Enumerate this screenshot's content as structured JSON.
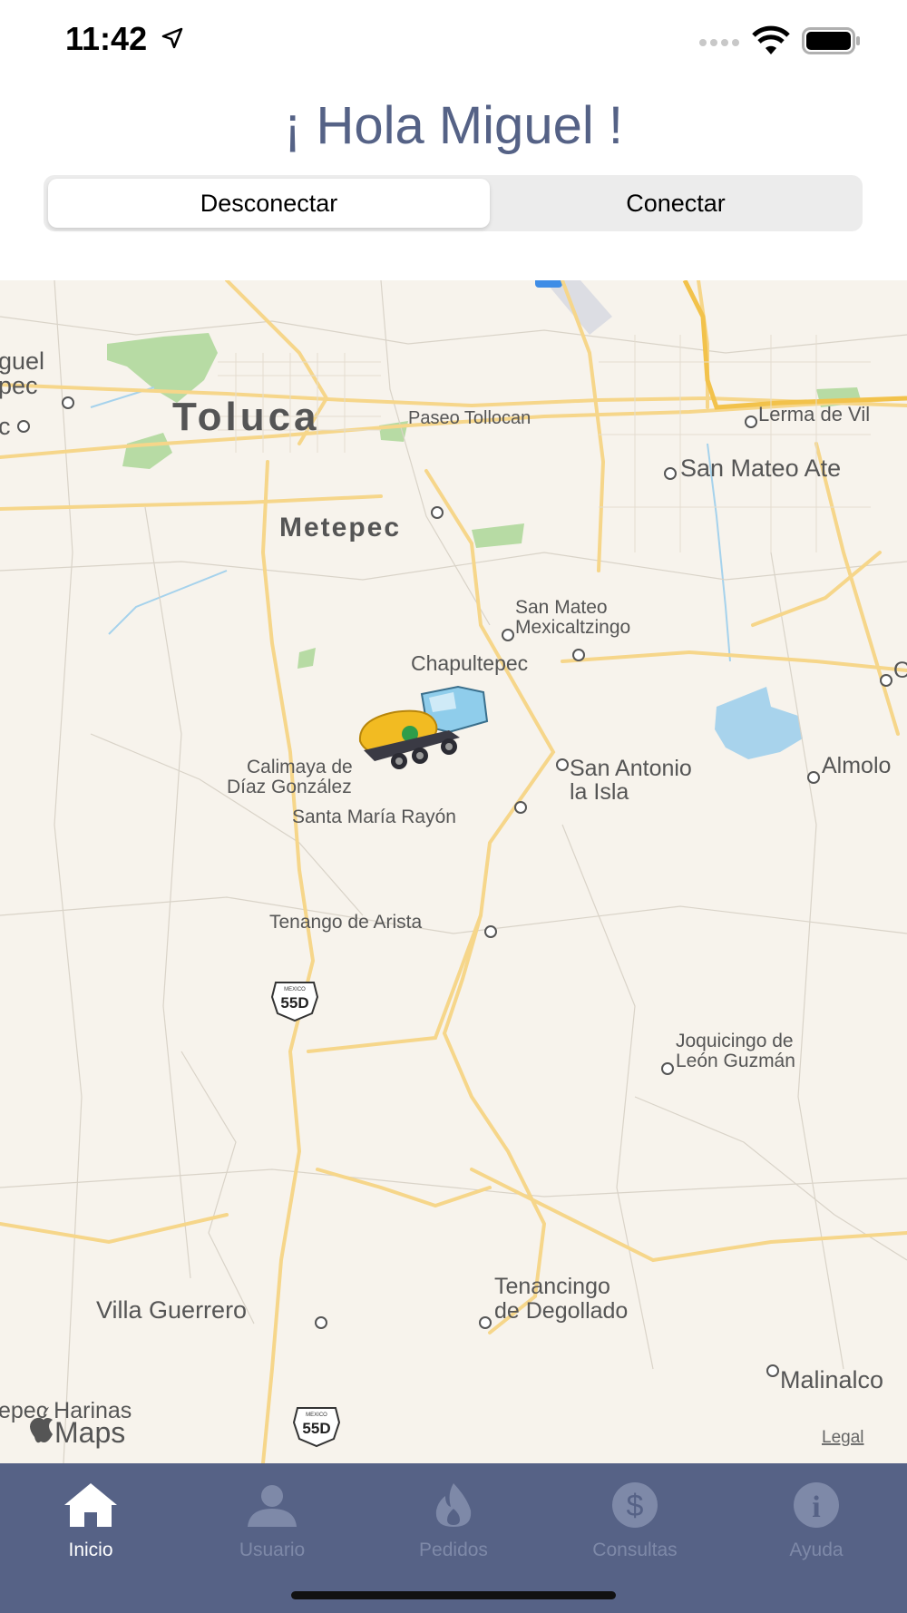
{
  "status_bar": {
    "time": "11:42"
  },
  "greeting": "¡ Hola Miguel !",
  "segmented": {
    "options": [
      "Desconectar",
      "Conectar"
    ],
    "selected": "Desconectar"
  },
  "map": {
    "labels": {
      "toluca": "Toluca",
      "metepec": "Metepec",
      "paseo": "Paseo Tollocan",
      "lerma": "Lerma de Vil",
      "san_mateo_ate": "San Mateo Ate",
      "miguel_l1": "guel",
      "miguel_l2": "pec",
      "c_left": "c",
      "san_mateo_mex_1": "San Mateo",
      "san_mateo_mex_2": "Mexicaltzingo",
      "chapultepec": "Chapultepec",
      "calimaya_1": "Calimaya de",
      "calimaya_2": "Díaz González",
      "santa_maria": "Santa María Rayón",
      "san_antonio_1": "San Antonio",
      "san_antonio_2": "la Isla",
      "almolo": "Almolo",
      "o_right": "O",
      "tenango": "Tenango de Arista",
      "joquicingo_1": "Joquicingo de",
      "joquicingo_2": "León Guzmán",
      "villa_guerrero": "Villa Guerrero",
      "tenancingo_1": "Tenancingo",
      "tenancingo_2": "de Degollado",
      "malinalco": "Malinalco",
      "harinas": "epec Harinas",
      "shield_top": "MEXICO",
      "shield_1": "55D",
      "shield_2": "55D",
      "maps_brand": "Maps",
      "legal": "Legal"
    }
  },
  "tabs": [
    {
      "label": "Inicio",
      "icon": "home-icon",
      "active": true
    },
    {
      "label": "Usuario",
      "icon": "user-icon",
      "active": false
    },
    {
      "label": "Pedidos",
      "icon": "flame-icon",
      "active": false
    },
    {
      "label": "Consultas",
      "icon": "dollar-icon",
      "active": false
    },
    {
      "label": "Ayuda",
      "icon": "info-icon",
      "active": false
    }
  ],
  "colors": {
    "accent": "#556286",
    "tabbar": "#566286",
    "map_bg": "#f7f3ec",
    "road": "#f5d27a",
    "park": "#a8d79a",
    "water": "#a5d2ec"
  }
}
